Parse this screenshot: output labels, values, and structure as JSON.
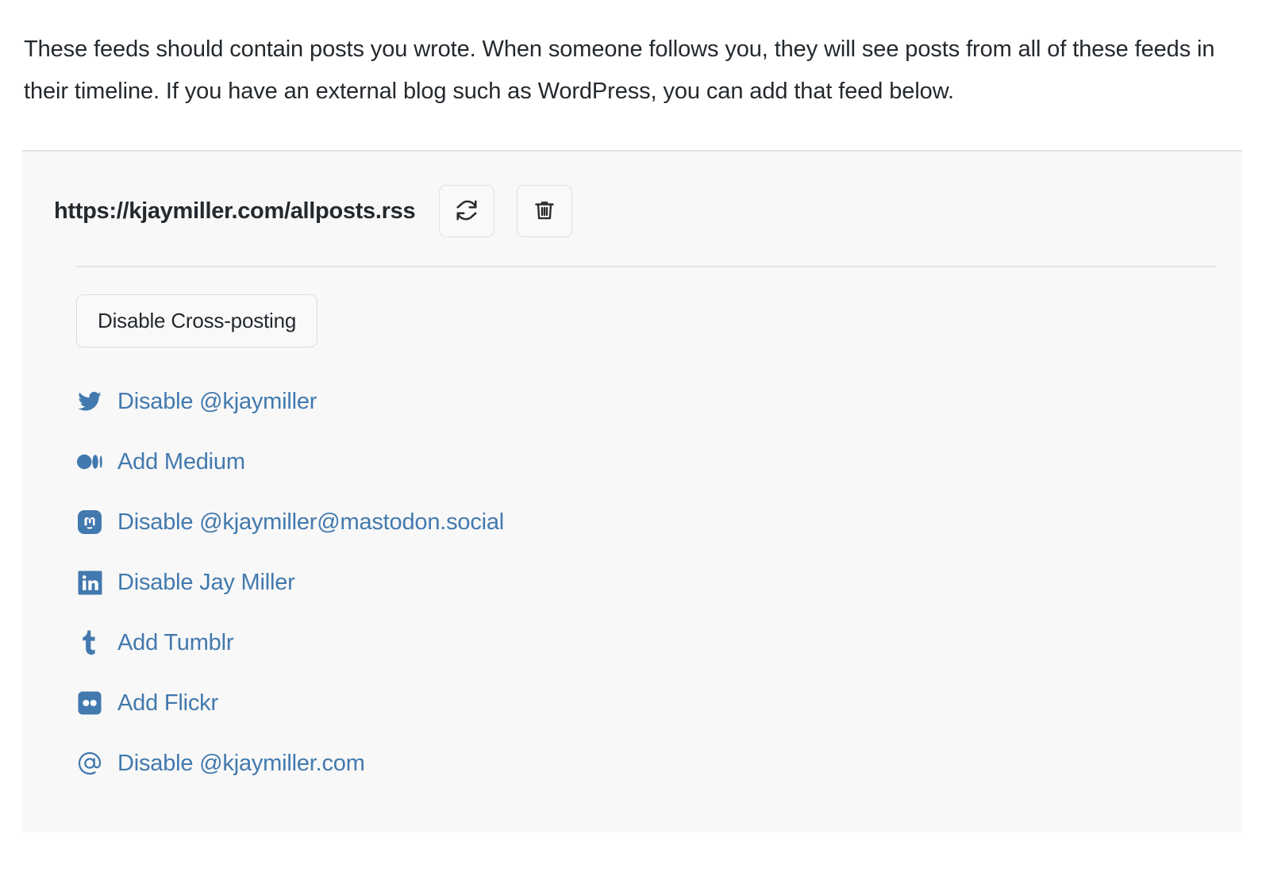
{
  "intro": {
    "paragraph": "These feeds should contain posts you wrote. When someone follows you, they will see posts from all of these feeds in their timeline. If you have an external blog such as WordPress, you can add that feed below."
  },
  "feed": {
    "url": "https://kjaymiller.com/allposts.rss",
    "refresh_icon": "refresh-icon",
    "delete_icon": "trash-icon",
    "refresh_title": "Refresh feed",
    "delete_title": "Delete feed"
  },
  "crosspost": {
    "toggle_label": "Disable Cross-posting"
  },
  "colors": {
    "link": "#4279ae",
    "text": "#24292e",
    "panel_bg": "#f8f8f8",
    "border": "#e2e2e2"
  },
  "social": {
    "items": [
      {
        "icon": "twitter-icon",
        "label": "Disable @kjaymiller"
      },
      {
        "icon": "medium-icon",
        "label": "Add Medium"
      },
      {
        "icon": "mastodon-icon",
        "label": "Disable @kjaymiller@mastodon.social"
      },
      {
        "icon": "linkedin-icon",
        "label": "Disable Jay Miller"
      },
      {
        "icon": "tumblr-icon",
        "label": "Add Tumblr"
      },
      {
        "icon": "flickr-icon",
        "label": "Add Flickr"
      },
      {
        "icon": "at-icon",
        "label": "Disable @kjaymiller.com"
      }
    ]
  }
}
